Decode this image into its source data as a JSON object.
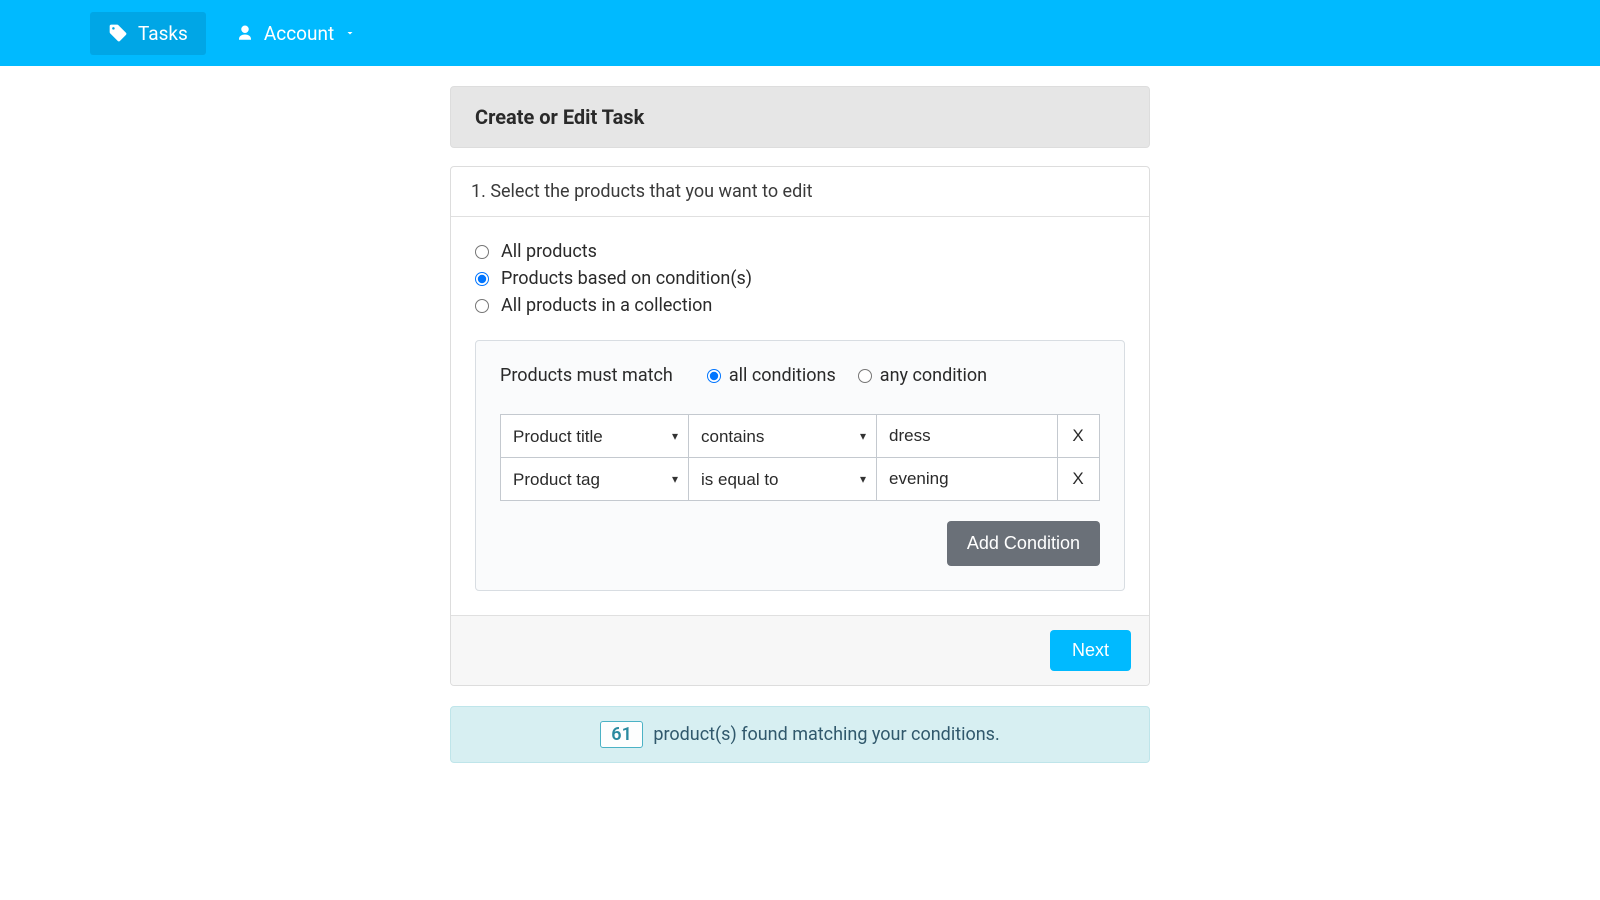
{
  "nav": {
    "tasks_label": "Tasks",
    "account_label": "Account"
  },
  "header": {
    "title": "Create or Edit Task"
  },
  "step": {
    "title": "1. Select the products that you want to edit"
  },
  "selection": {
    "options": [
      {
        "label": "All products",
        "value": "all",
        "checked": false
      },
      {
        "label": "Products based on condition(s)",
        "value": "conditions",
        "checked": true
      },
      {
        "label": "All products in a collection",
        "value": "collection",
        "checked": false
      }
    ]
  },
  "conditions": {
    "match_label": "Products must match",
    "match_options": [
      {
        "label": "all conditions",
        "value": "all",
        "checked": true
      },
      {
        "label": "any condition",
        "value": "any",
        "checked": false
      }
    ],
    "rows": [
      {
        "field": "Product title",
        "operator": "contains",
        "value": "dress",
        "remove_label": "X"
      },
      {
        "field": "Product tag",
        "operator": "is equal to",
        "value": "evening",
        "remove_label": "X"
      }
    ],
    "add_label": "Add Condition"
  },
  "footer": {
    "next_label": "Next"
  },
  "info": {
    "count": "61",
    "text": "product(s) found matching your conditions."
  }
}
